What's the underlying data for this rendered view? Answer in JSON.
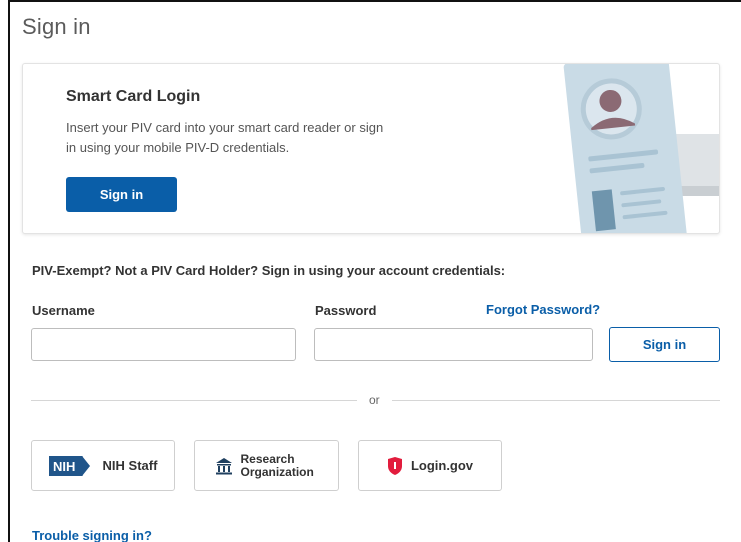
{
  "page": {
    "title": "Sign in"
  },
  "smart_card": {
    "title": "Smart Card Login",
    "description": "Insert your PIV card into your smart card reader or sign in using your mobile PIV-D credentials.",
    "sign_in_label": "Sign in"
  },
  "credentials": {
    "prompt": "PIV-Exempt? Not a PIV Card Holder? Sign in using your account credentials:",
    "username_label": "Username",
    "username_value": "",
    "password_label": "Password",
    "password_value": "",
    "forgot_password_label": "Forgot Password?",
    "sign_in_label": "Sign in"
  },
  "divider": {
    "or_label": "or"
  },
  "alt_logins": {
    "nih_badge": "NIH",
    "nih_label": "NIH Staff",
    "research_label": "Research Organization",
    "logingov_label": "Login.gov"
  },
  "footer": {
    "trouble_label": "Trouble signing in?"
  },
  "colors": {
    "primary": "#0a5ea8",
    "logingov_red": "#e21c3d",
    "nih_badge": "#20558a"
  }
}
